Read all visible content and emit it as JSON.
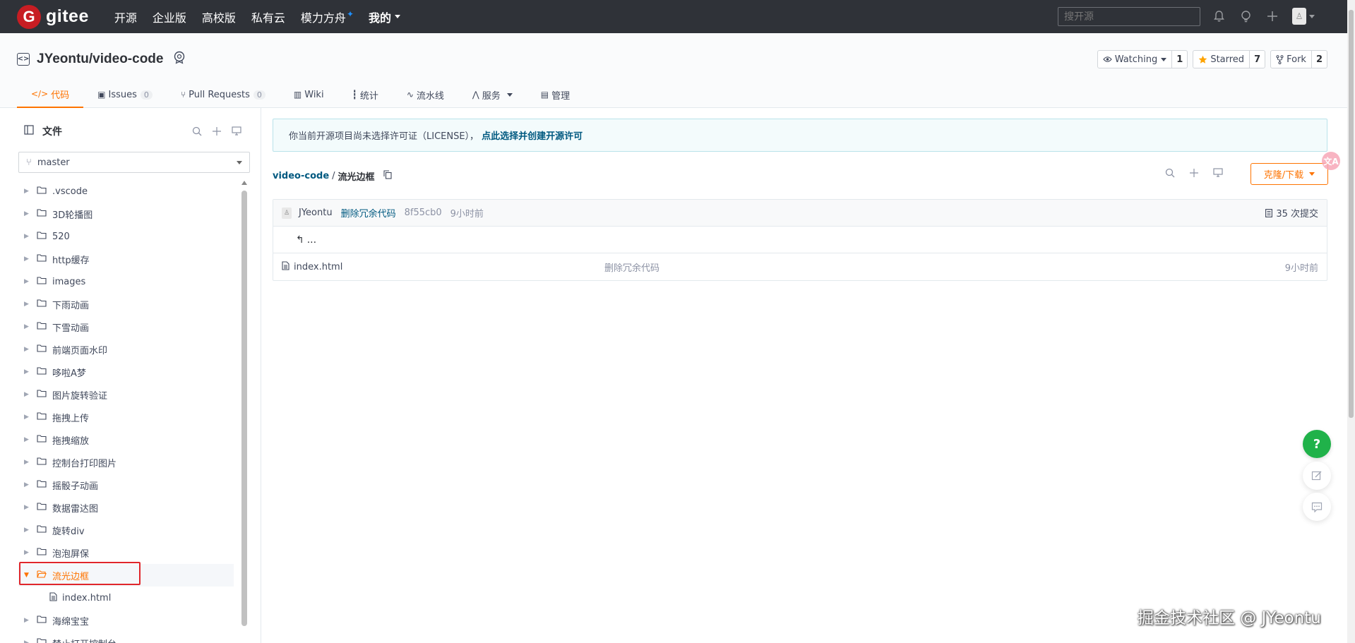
{
  "nav": {
    "logo_letter": "G",
    "logo_text": "gitee",
    "links": [
      "开源",
      "企业版",
      "高校版",
      "私有云",
      "模力方舟"
    ],
    "mine": "我的",
    "search_placeholder": "搜开源"
  },
  "repo": {
    "name": "JYeontu/video-code",
    "watch_label": "Watching",
    "watch_count": "1",
    "star_label": "Starred",
    "star_count": "7",
    "fork_label": "Fork",
    "fork_count": "2"
  },
  "tabs": [
    {
      "label": "代码",
      "icon": "</>"
    },
    {
      "label": "Issues",
      "count": "0"
    },
    {
      "label": "Pull Requests",
      "count": "0"
    },
    {
      "label": "Wiki"
    },
    {
      "label": "统计"
    },
    {
      "label": "流水线"
    },
    {
      "label": "服务"
    },
    {
      "label": "管理"
    }
  ],
  "sidebar": {
    "title": "文件",
    "branch": "master",
    "items": [
      ".vscode",
      "3D轮播图",
      "520",
      "http缓存",
      "images",
      "下雨动画",
      "下雪动画",
      "前端页面水印",
      "哆啦A梦",
      "图片旋转验证",
      "拖拽上传",
      "拖拽缩放",
      "控制台打印图片",
      "摇骰子动画",
      "数据雷达图",
      "旋转div",
      "泡泡屏保",
      "流光边框",
      "index.html",
      "海绵宝宝",
      "禁止打开控制台"
    ]
  },
  "notice": {
    "text": "你当前开源项目尚未选择许可证（LICENSE），",
    "link": "点此选择并创建开源许可"
  },
  "breadcrumb": {
    "root": "video-code",
    "sep": "/",
    "current": "流光边框"
  },
  "clone_label": "克隆/下载",
  "commit": {
    "author": "JYeontu",
    "message": "删除冗余代码",
    "sha": "8f55cb0",
    "time": "9小时前",
    "total": "35 次提交"
  },
  "back_label": "...",
  "files": [
    {
      "name": "index.html",
      "message": "删除冗余代码",
      "time": "9小时前"
    }
  ],
  "translate_badge": "文A",
  "help_label": "?",
  "watermark": "掘金技术社区 @ JYeontu",
  "colors": {
    "accent": "#fe7300",
    "nav_bg": "#2f3238",
    "link": "#005980",
    "highlight_box": "#e0262b"
  }
}
